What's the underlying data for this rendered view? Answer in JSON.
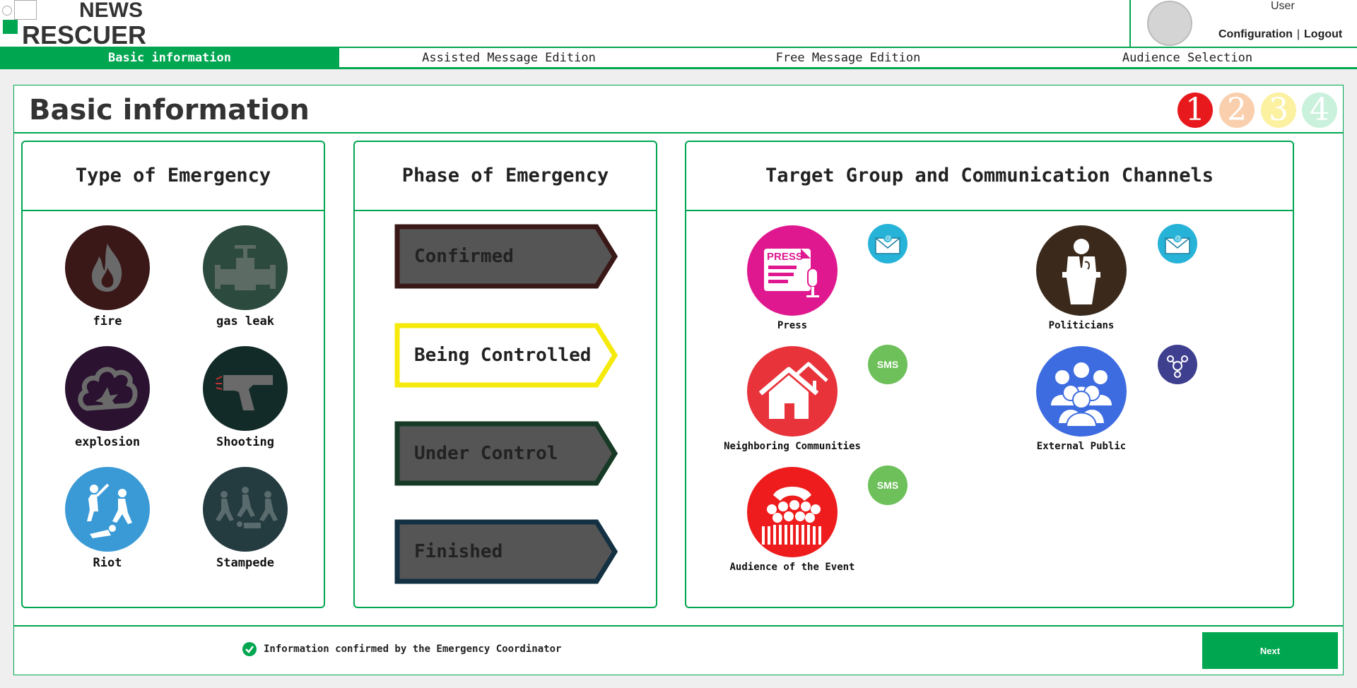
{
  "app": {
    "logo_line1": "NEWS",
    "logo_line2": "RESCUER"
  },
  "user": {
    "name": "User",
    "configuration": "Configuration",
    "separator": "|",
    "logout": "Logout"
  },
  "tabs": [
    {
      "label": "Basic information",
      "active": true
    },
    {
      "label": "Assisted Message Edition",
      "active": false
    },
    {
      "label": "Free Message Edition",
      "active": false
    },
    {
      "label": "Audience Selection",
      "active": false
    }
  ],
  "page": {
    "title": "Basic information"
  },
  "steps": [
    {
      "label": "1",
      "color": "#e8191d"
    },
    {
      "label": "2",
      "color": "#f9cfae"
    },
    {
      "label": "3",
      "color": "#fbf1a1"
    },
    {
      "label": "4",
      "color": "#c9f1dc"
    }
  ],
  "emergency_type": {
    "heading": "Type of Emergency",
    "items": [
      {
        "label": "fire",
        "icon": "fire-icon",
        "color": "#3a1818"
      },
      {
        "label": "gas leak",
        "icon": "pipe-valve-icon",
        "color": "#2d4a3e"
      },
      {
        "label": "explosion",
        "icon": "explosion-icon",
        "color": "#2a1230"
      },
      {
        "label": "Shooting",
        "icon": "pistol-icon",
        "color": "#132b28"
      },
      {
        "label": "Riot",
        "icon": "riot-icon",
        "color": "#3a9ad6"
      },
      {
        "label": "Stampede",
        "icon": "stampede-icon",
        "color": "#243b40"
      }
    ]
  },
  "emergency_phase": {
    "heading": "Phase of Emergency",
    "items": [
      {
        "label": "Confirmed",
        "fill": "#555555",
        "stroke": "#3a1818",
        "selected": false
      },
      {
        "label": "Being Controlled",
        "fill": "#ffffff",
        "stroke": "#f5ea0c",
        "selected": true
      },
      {
        "label": "Under Control",
        "fill": "#555555",
        "stroke": "#163a26",
        "selected": false
      },
      {
        "label": "Finished",
        "fill": "#555555",
        "stroke": "#133142",
        "selected": false
      }
    ]
  },
  "targets": {
    "heading": "Target Group and Communication Channels",
    "items": [
      {
        "label": "Press",
        "icon": "press-icon",
        "color": "#e0188f",
        "channel": "email",
        "channel_color": "#27b3d8"
      },
      {
        "label": "Politicians",
        "icon": "politician-podium-icon",
        "color": "#3b2a1c",
        "channel": "email",
        "channel_color": "#27b3d8"
      },
      {
        "label": "Neighboring Communities",
        "icon": "houses-icon",
        "color": "#e8333b",
        "channel": "SMS",
        "channel_color": "#6ec05a"
      },
      {
        "label": "External Public",
        "icon": "people-group-icon",
        "color": "#3d6ce0",
        "channel": "social",
        "channel_color": "#3f3f8f"
      },
      {
        "label": "Audience of the Event",
        "icon": "crowd-icon",
        "color": "#ee1c1c",
        "channel": "SMS",
        "channel_color": "#6ec05a"
      }
    ]
  },
  "footer": {
    "confirmation": "Information confirmed by the Emergency Coordinator",
    "next_label": "Next"
  }
}
